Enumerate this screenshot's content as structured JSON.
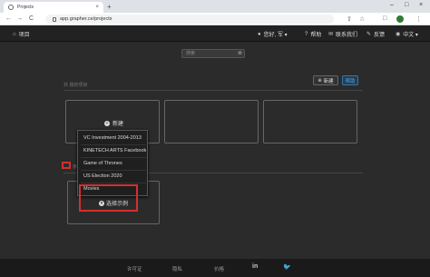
{
  "browser": {
    "tab_title": "Projects",
    "tab_close": "×",
    "new_tab": "+",
    "win_min": "–",
    "win_max": "□",
    "win_close": "×",
    "back": "←",
    "forward": "→",
    "reload": "C",
    "url": "app.grapher.ce/projects",
    "share_icon": "⇧",
    "star_icon": "☆",
    "ext_icon": "□",
    "menu_icon": "⋮"
  },
  "navbar": {
    "home": "项目",
    "user": "您好, 军 ▾",
    "help": "帮助",
    "contact": "联系我们",
    "feedback": "反馈",
    "language": "中文 ▾"
  },
  "search": {
    "placeholder": "搜索",
    "clear": "⊗"
  },
  "section": {
    "label": "共 我的项目"
  },
  "toolbar": {
    "new_label": "新建",
    "help_label": "帮助"
  },
  "card_new": {
    "label": "新建"
  },
  "row": {
    "text": "示例"
  },
  "dropdown": {
    "items": [
      "VC Investment 2004-2013",
      "KINETECH ARTS Facebook",
      "Game of Thrones",
      "US Election 2020",
      "Movies"
    ]
  },
  "example_button": {
    "label": "选择示例"
  },
  "footer": {
    "license": "许可证",
    "privacy": "隐私",
    "pricing": "价格",
    "linkedin": "in",
    "twitter": "🐦"
  }
}
